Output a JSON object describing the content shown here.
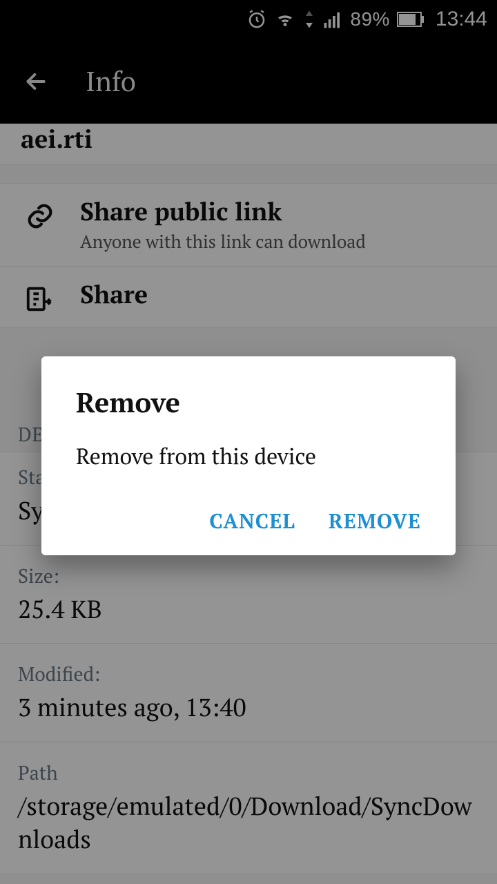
{
  "statusBar": {
    "battery": "89%",
    "time": "13:44"
  },
  "appBar": {
    "title": "Info"
  },
  "fileName": "aei.rti",
  "shareLink": {
    "title": "Share public link",
    "subtitle": "Anyone with this link can download"
  },
  "share": {
    "title": "Share"
  },
  "detailsHeader": "DETAILS",
  "statusRow": {
    "label": "Status:",
    "value": "Synced"
  },
  "size": {
    "label": "Size:",
    "value": "25.4 KB"
  },
  "modified": {
    "label": "Modified:",
    "value": "3 minutes ago, 13:40"
  },
  "path": {
    "label": "Path",
    "value": "/storage/emulated/0/Download/SyncDownloads"
  },
  "dialog": {
    "title": "Remove",
    "message": "Remove from this device",
    "cancel": "CANCEL",
    "confirm": "REMOVE"
  }
}
